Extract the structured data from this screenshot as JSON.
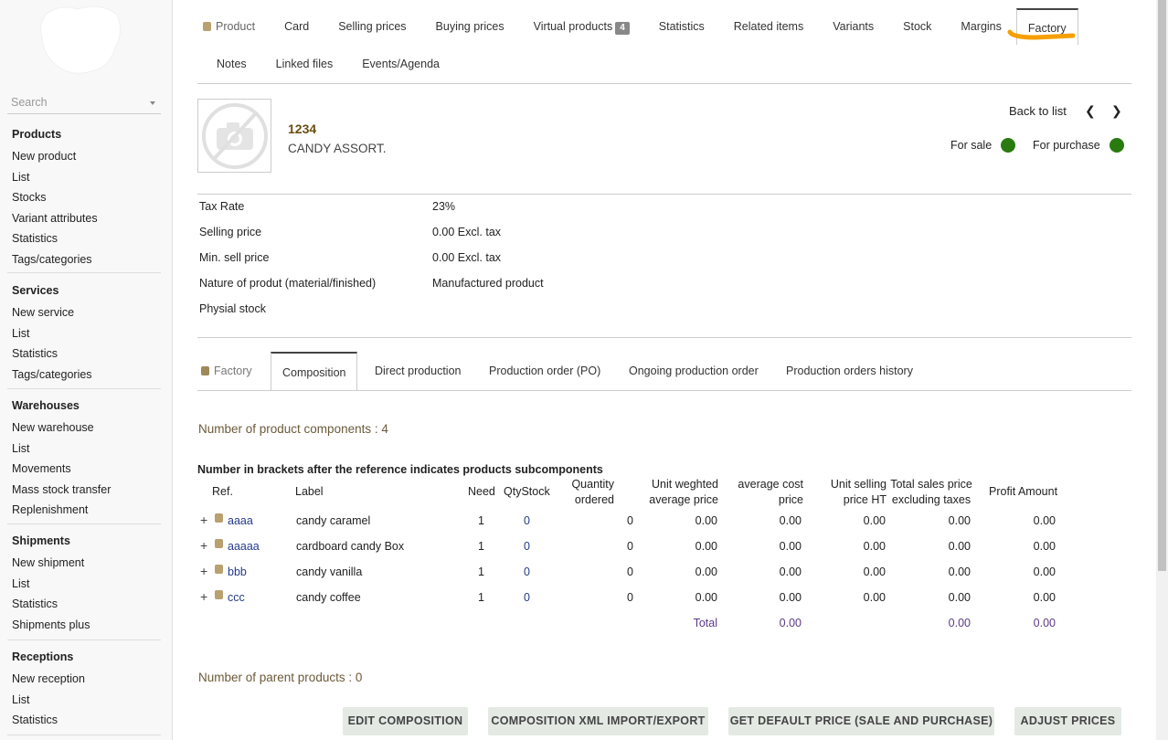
{
  "sidebar": {
    "search_placeholder": "Search",
    "sections": [
      {
        "title": "Products",
        "items": [
          "New product",
          "List",
          "Stocks",
          "Variant attributes",
          "Statistics",
          "Tags/categories"
        ]
      },
      {
        "title": "Services",
        "items": [
          "New service",
          "List",
          "Statistics",
          "Tags/categories"
        ]
      },
      {
        "title": "Warehouses",
        "items": [
          "New warehouse",
          "List",
          "Movements",
          "Mass stock transfer",
          "Replenishment"
        ]
      },
      {
        "title": "Shipments",
        "items": [
          "New shipment",
          "List",
          "Statistics",
          "Shipments plus"
        ]
      },
      {
        "title": "Receptions",
        "items": [
          "New reception",
          "List",
          "Statistics"
        ]
      }
    ]
  },
  "tabs": {
    "row1": [
      "Product",
      "Card",
      "Selling prices",
      "Buying prices",
      "Virtual products",
      "Statistics",
      "Related items",
      "Variants",
      "Stock",
      "Margins",
      "Factory"
    ],
    "virtual_badge": "4",
    "row2": [
      "Notes",
      "Linked files",
      "Events/Agenda"
    ],
    "active": "Factory",
    "highlight_color": "#f5a000"
  },
  "product": {
    "ref": "1234",
    "label": "CANDY ASSORT.",
    "back_to_list": "Back to list",
    "for_sale": "For sale",
    "for_purchase": "For purchase",
    "status_color": "#297b0f"
  },
  "info": {
    "rows": [
      {
        "label": "Tax Rate",
        "value": "23%"
      },
      {
        "label": "Selling price",
        "value": "0.00 Excl. tax"
      },
      {
        "label": "Min. sell price",
        "value": "0.00 Excl. tax"
      },
      {
        "label": "Nature of produt (material/finished)",
        "value": "Manufactured product"
      },
      {
        "label": "Physial stock",
        "value": ""
      }
    ]
  },
  "subtabs": {
    "items": [
      "Factory",
      "Composition",
      "Direct production",
      "Production order (PO)",
      "Ongoing production order",
      "Production orders history"
    ],
    "active": "Composition"
  },
  "composition": {
    "count_text": "Number of product components : 4",
    "note": "Number in brackets after the reference indicates products subcomponents",
    "headers": {
      "ref": "Ref.",
      "label": "Label",
      "need": "Need",
      "qtystock": "QtyStock",
      "qty_ordered_1": "Quantity",
      "qty_ordered_2": "ordered",
      "unit_wap_1": "Unit weghted",
      "unit_wap_2": "average price",
      "avg_cost_1": "average cost",
      "avg_cost_2": "price",
      "unit_sell_1": "Unit selling",
      "unit_sell_2": "price HT",
      "total_sales_1": "Total sales price",
      "total_sales_2": "excluding taxes",
      "profit": "Profit Amount"
    },
    "rows": [
      {
        "ref": "aaaa",
        "label": "candy caramel",
        "need": "1",
        "qtystock": "0",
        "qty_ordered": "0",
        "unit_wap": "0.00",
        "avg_cost": "0.00",
        "unit_sell": "0.00",
        "total_sales": "0.00",
        "profit": "0.00"
      },
      {
        "ref": "aaaaa",
        "label": "cardboard candy Box",
        "need": "1",
        "qtystock": "0",
        "qty_ordered": "0",
        "unit_wap": "0.00",
        "avg_cost": "0.00",
        "unit_sell": "0.00",
        "total_sales": "0.00",
        "profit": "0.00"
      },
      {
        "ref": "bbb",
        "label": "candy vanilla",
        "need": "1",
        "qtystock": "0",
        "qty_ordered": "0",
        "unit_wap": "0.00",
        "avg_cost": "0.00",
        "unit_sell": "0.00",
        "total_sales": "0.00",
        "profit": "0.00"
      },
      {
        "ref": "ccc",
        "label": "candy coffee",
        "need": "1",
        "qtystock": "0",
        "qty_ordered": "0",
        "unit_wap": "0.00",
        "avg_cost": "0.00",
        "unit_sell": "0.00",
        "total_sales": "0.00",
        "profit": "0.00"
      }
    ],
    "total": {
      "label": "Total",
      "avg_cost": "0.00",
      "total_sales": "0.00",
      "profit": "0.00"
    },
    "parent_count_text": "Number of parent products : 0"
  },
  "buttons": [
    "EDIT COMPOSITION",
    "COMPOSITION XML IMPORT/EXPORT",
    "GET DEFAULT PRICE (SALE AND PURCHASE)",
    "ADJUST PRICES"
  ]
}
